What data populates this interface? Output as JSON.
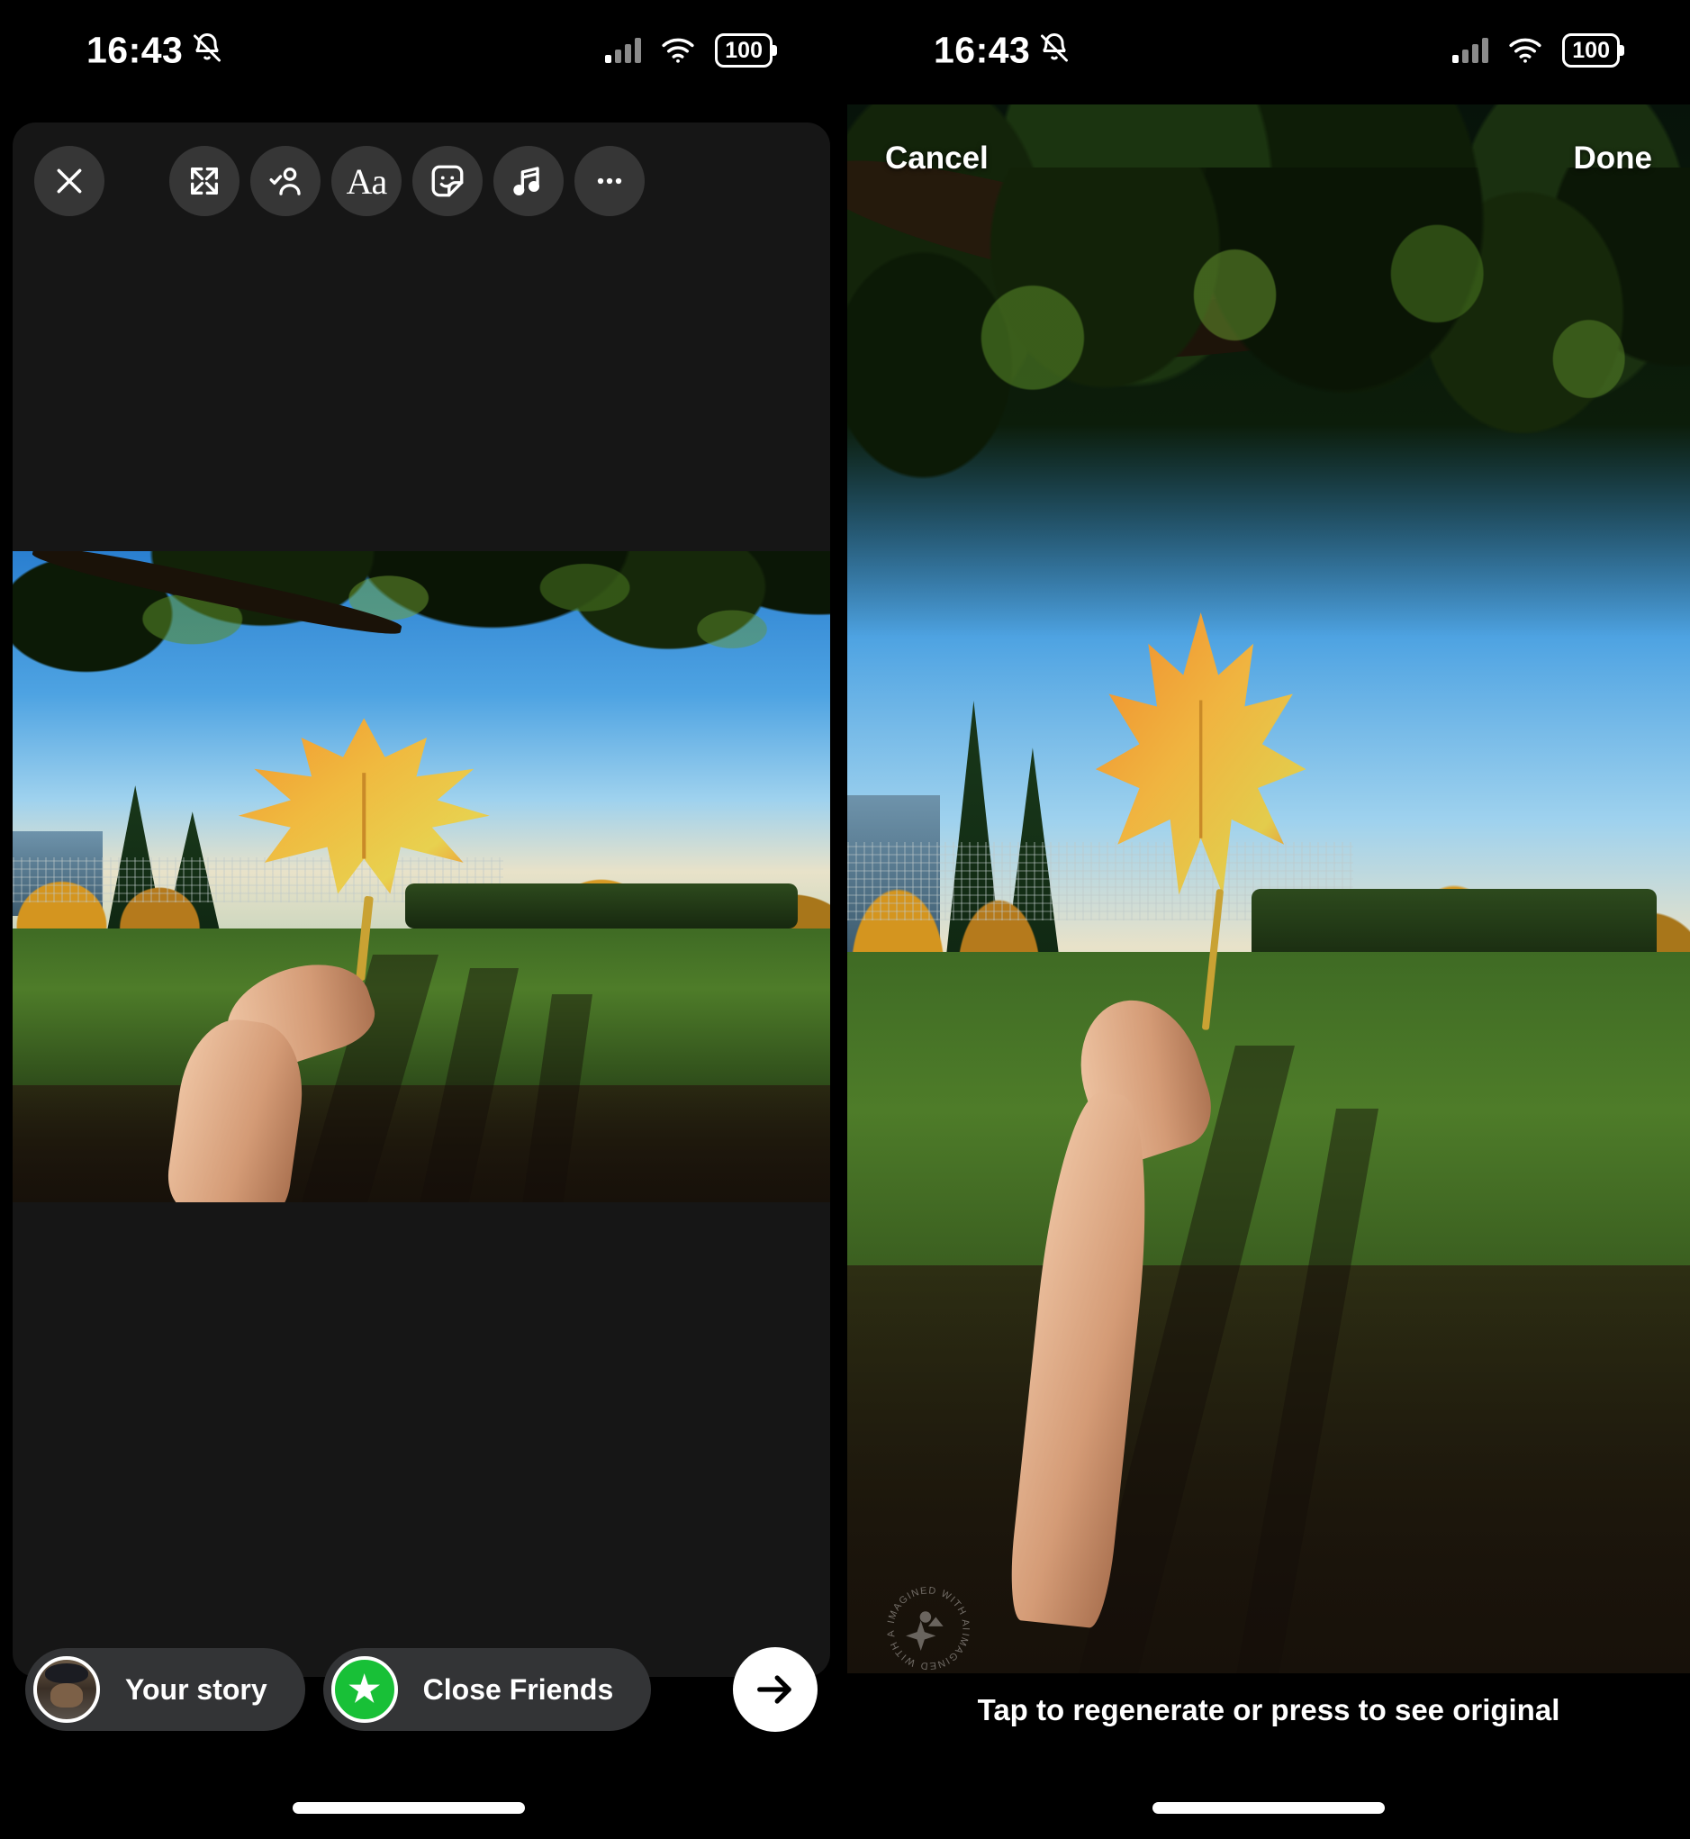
{
  "status_bar": {
    "time": "16:43",
    "battery": "100",
    "icons": [
      "bell-muted-icon",
      "cellular-signal-icon",
      "wifi-icon",
      "battery-icon"
    ]
  },
  "left_panel": {
    "name": "instagram-story-composer",
    "toolbar": {
      "close_label": "✕",
      "items": [
        {
          "name": "close-button",
          "icon": "close-x-icon",
          "label": "Close"
        },
        {
          "name": "expand-button",
          "icon": "expand-arrows-icon",
          "label": "Expand"
        },
        {
          "name": "tag-people-button",
          "icon": "person-check-icon",
          "label": "Tag people"
        },
        {
          "name": "text-button",
          "icon": "text-aa-icon",
          "label": "Aa"
        },
        {
          "name": "sticker-button",
          "icon": "sticker-smiley-icon",
          "label": "Stickers"
        },
        {
          "name": "music-button",
          "icon": "music-note-icon",
          "label": "Music"
        },
        {
          "name": "more-options-button",
          "icon": "ellipsis-icon",
          "label": "More"
        }
      ]
    },
    "action_bar": {
      "your_story_label": "Your story",
      "close_friends_label": "Close Friends",
      "next_icon": "arrow-right-icon",
      "avatar_name": "user-avatar",
      "close_friends_badge": "star-icon",
      "close_friends_color": "#18c037"
    },
    "photo": {
      "alt": "Hand holding an orange maple leaf in front of an autumn backyard with trees, lawn and long shadows"
    }
  },
  "right_panel": {
    "name": "ai-restyle-preview",
    "nav": {
      "cancel_label": "Cancel",
      "done_label": "Done"
    },
    "caption": "Tap to regenerate or press to see original",
    "watermark": {
      "text": "IMAGINED WITH AI",
      "icon": "ai-sparkle-icon"
    },
    "photo": {
      "alt": "AI-expanded version of the same maple leaf photo, taller framing showing more of the tree canopy and forearm"
    }
  },
  "colors": {
    "background": "#000000",
    "canvas": "#161616",
    "pill": "#333436",
    "accent_green": "#18c037",
    "text": "#ffffff"
  }
}
